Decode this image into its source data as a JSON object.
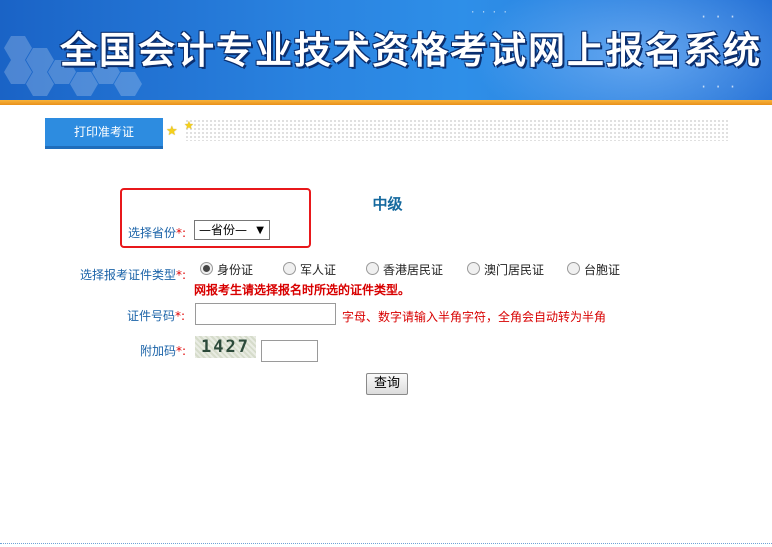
{
  "header": {
    "title": "全国会计专业技术资格考试网上报名系统",
    "accent_color": "#2a83e0",
    "bar_color": "#f0a228"
  },
  "tab": {
    "label": "打印准考证"
  },
  "form": {
    "level": "中级",
    "province_label": "选择省份",
    "required_mark": "*:",
    "province_value": "—省份—",
    "id_type_label": "选择报考证件类型",
    "id_types": [
      {
        "label": "身份证",
        "checked": true
      },
      {
        "label": "军人证",
        "checked": false
      },
      {
        "label": "香港居民证",
        "checked": false
      },
      {
        "label": "澳门居民证",
        "checked": false
      },
      {
        "label": "台胞证",
        "checked": false
      }
    ],
    "id_type_warning": "网报考生请选择报名时所选的证件类型。",
    "id_number_label": "证件号码",
    "id_number_value": "",
    "id_number_hint": "字母、数字请输入半角字符，全角会自动转为半角",
    "captcha_label": "附加码",
    "captcha_text": "1427",
    "captcha_value": "",
    "submit_label": "查询"
  }
}
